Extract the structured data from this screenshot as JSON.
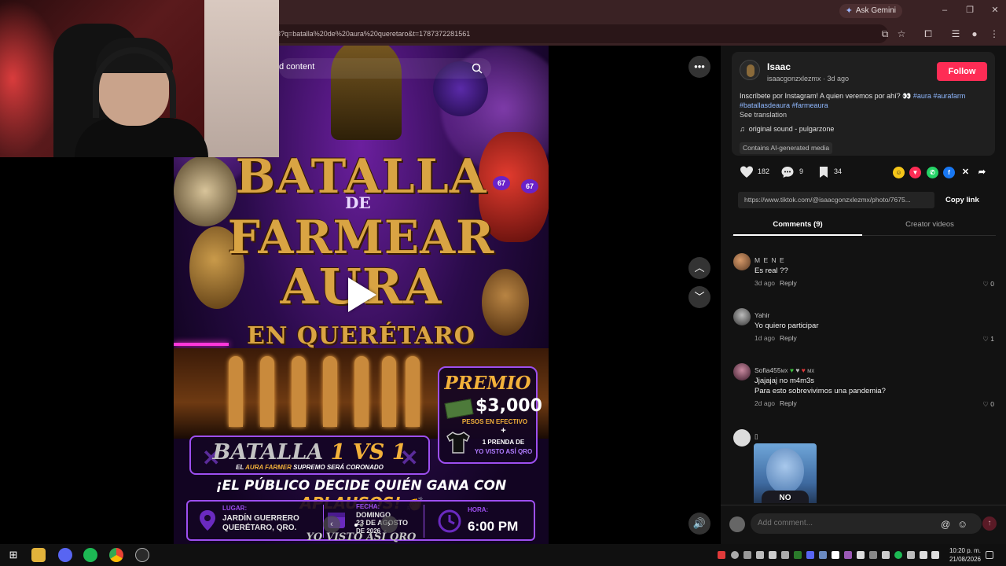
{
  "browser": {
    "ask_gemini": "Ask Gemini",
    "url": "3?q=batalla%20de%20aura%20queretaro&t=1787372281561"
  },
  "video": {
    "search_text": "d content",
    "poster": {
      "line1": "BATALLA",
      "line2": "DE",
      "line3": "FARMEAR",
      "line4": "AURA",
      "line5": "EN QUERÉTARO",
      "premio_title": "PREMIO",
      "premio_amount": "$3,000",
      "premio_line1": "PESOS EN EFECTIVO",
      "premio_plus": "+",
      "premio_line2": "1 PRENDA DE",
      "premio_line3": "YO VISTO ASÍ QRO",
      "vs_prefix": "BATALLA ",
      "vs_gold": "1 VS 1",
      "vs_sub_prefix": "EL ",
      "vs_sub_gold": "AURA FARMER",
      "vs_sub_suffix": " SUPREMO SERÁ CORONADO",
      "aplausos_prefix": "¡EL PÚBLICO DECIDE QUIÉN GANA CON ",
      "aplausos_gold": "APLAUSOS!",
      "lugar_label": "LUGAR:",
      "lugar_val1": "JARDÍN GUERRERO",
      "lugar_val2": "QUERÉTARO, QRO.",
      "fecha_label": "FECHA:",
      "fecha_val1": "DOMINGO",
      "fecha_val2": "23 DE AGOSTO",
      "fecha_val3": "DE 2026",
      "hora_label": "HORA:",
      "hora_val": "6:00 PM",
      "footer": "YO VISTO ASÍ QRO"
    }
  },
  "profile": {
    "username": "Isaac",
    "handle": "isaacgonzxlezmx · 3d ago",
    "follow_label": "Follow",
    "desc_text": "Inscríbete por Instagram! A quien veremos por ahí? 👀 ",
    "desc_tags1": "#aura #aurafarm",
    "desc_tags2": "#batallasdeaura #farmeaura",
    "see_translation": "See translation",
    "sound": "original sound - pulgarzone",
    "ai_badge": "Contains AI-generated media"
  },
  "actions": {
    "likes": "182",
    "comments": "9",
    "saves": "34",
    "link": "https://www.tiktok.com/@isaacgonzxlezmx/photo/7675...",
    "copy_link": "Copy link"
  },
  "tabs": {
    "comments": "Comments (9)",
    "creator_videos": "Creator videos"
  },
  "comments": [
    {
      "name": "M E N E",
      "text": "Es real ??",
      "date": "3d ago",
      "reply": "Reply",
      "likes": "0"
    },
    {
      "name": "Yahir",
      "text": "Yo quiero participar",
      "date": "1d ago",
      "reply": "Reply",
      "likes": "1"
    },
    {
      "name": "Sofia455",
      "name_suffix": "MX",
      "name_suffix2": "MX",
      "text": "Jjajajaj no m4m3s",
      "text2": "Para esto sobrevivimos una pandemia?",
      "date": "2d ago",
      "reply": "Reply",
      "likes": "0"
    },
    {
      "name": "",
      "image_text": "NO"
    }
  ],
  "comment_input": {
    "placeholder": "Add comment..."
  },
  "taskbar": {
    "time": "10:20 p. m.",
    "date": "21/08/2026"
  }
}
